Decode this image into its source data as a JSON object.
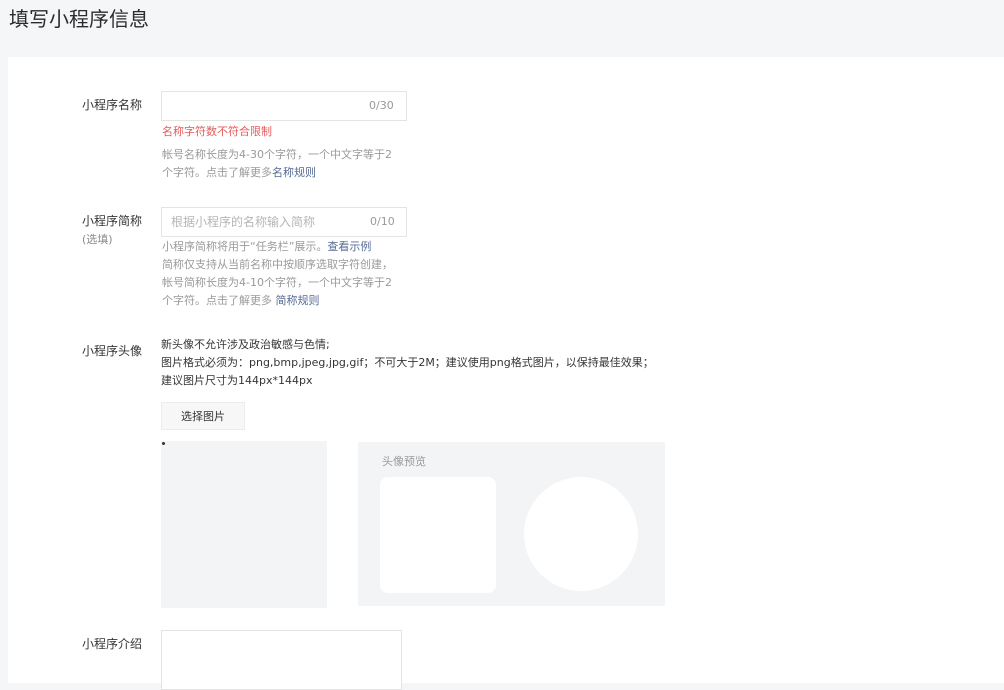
{
  "page": {
    "title": "填写小程序信息"
  },
  "name_field": {
    "label": "小程序名称",
    "value": "",
    "placeholder": "",
    "counter": "0/30",
    "error": "名称字符数不符合限制",
    "hint_line1": "帐号名称长度为4-30个字符，一个中文字等于2",
    "hint_line2_prefix": "个字符。点击了解更多",
    "hint_link": "名称规则"
  },
  "short_name_field": {
    "label": "小程序简称",
    "optional": "(选填)",
    "value": "",
    "placeholder": "根据小程序的名称输入简称",
    "counter": "0/10",
    "hint_line1_prefix": "小程序简称将用于“任务栏”展示。",
    "hint_line1_link": "查看示例",
    "hint_line2": "简称仅支持从当前名称中按顺序选取字符创建，",
    "hint_line3": "帐号简称长度为4-10个字符，一个中文字等于2",
    "hint_line4_prefix": "个字符。点击了解更多 ",
    "hint_line4_link": "简称规则"
  },
  "avatar_field": {
    "label": "小程序头像",
    "rule_line1": "新头像不允许涉及政治敏感与色情;",
    "rule_line2": "图片格式必须为：png,bmp,jpeg,jpg,gif；不可大于2M；建议使用png格式图片，以保持最佳效果；",
    "rule_line3": "建议图片尺寸为144px*144px",
    "select_button": "选择图片",
    "preview_title": "头像预览"
  },
  "intro_field": {
    "label": "小程序介绍",
    "value": ""
  }
}
